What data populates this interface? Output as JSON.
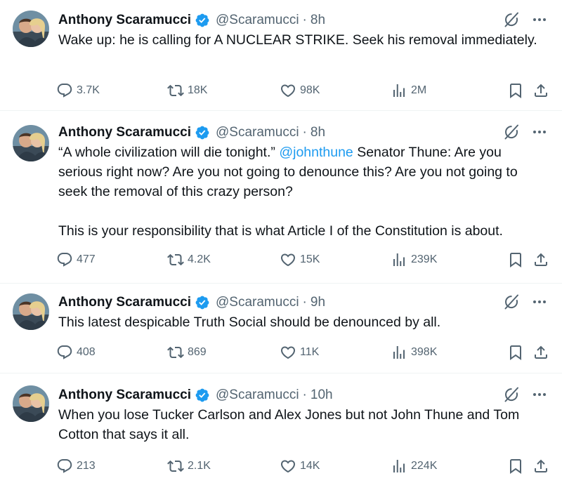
{
  "author": {
    "name": "Anthony Scaramucci",
    "handle": "@Scaramucci",
    "verified": true
  },
  "colors": {
    "verified": "#1d9bf0",
    "mention": "#1d9bf0",
    "secondary_text": "#536471",
    "divider": "#eff3f4"
  },
  "tweets": [
    {
      "time": "8h",
      "text": "Wake up:  he is calling for A NUCLEAR STRIKE.  Seek his removal immediately.",
      "stats": {
        "replies": "3.7K",
        "retweets": "18K",
        "likes": "98K",
        "views": "2M"
      }
    },
    {
      "time": "8h",
      "text_before": "“A whole civilization will die tonight.” ",
      "mention": "@johnthune",
      "text_after": " Senator Thune: Are you serious right now? Are you not going to denounce this? Are you not going to seek the removal of this crazy person?\n\nThis is your responsibility that is what Article I of the Constitution is about.",
      "stats": {
        "replies": "477",
        "retweets": "4.2K",
        "likes": "15K",
        "views": "239K"
      }
    },
    {
      "time": "9h",
      "text": "This latest despicable Truth Social should be denounced by all.",
      "stats": {
        "replies": "408",
        "retweets": "869",
        "likes": "11K",
        "views": "398K"
      }
    },
    {
      "time": "10h",
      "text": "When you lose Tucker Carlson and Alex Jones but not John Thune and Tom Cotton that says it all.",
      "stats": {
        "replies": "213",
        "retweets": "2.1K",
        "likes": "14K",
        "views": "224K"
      }
    }
  ],
  "icons": {
    "reply": "reply-icon",
    "retweet": "retweet-icon",
    "like": "heart-icon",
    "views": "views-icon",
    "bookmark": "bookmark-icon",
    "share": "share-icon",
    "grok": "grok-icon",
    "more": "more-icon"
  }
}
